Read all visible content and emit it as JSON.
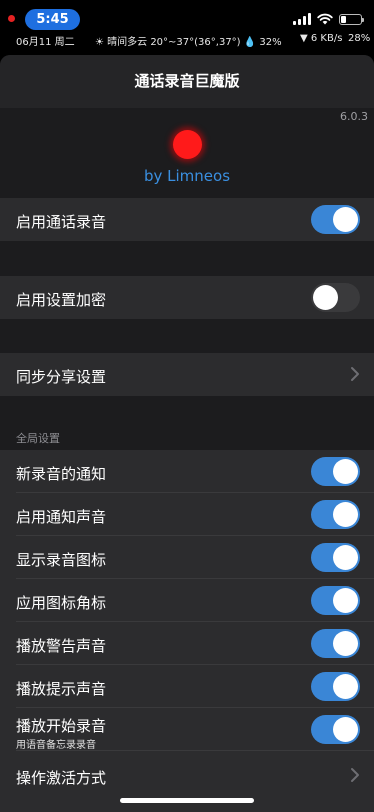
{
  "status_bar": {
    "time": "5:45",
    "battery_level": 0.25
  },
  "info_bar": {
    "date": "06月11 周二",
    "weather": "☀ 晴间多云 20°~37°(36°,37°) 💧 32%",
    "speed": "▼ 6 KB/s",
    "battery_percent": "28%"
  },
  "nav": {
    "title": "通话录音巨魔版"
  },
  "header": {
    "version": "6.0.3",
    "byline": "by Limneos",
    "dot_color": "#ff1a1a"
  },
  "cells": {
    "enable_recording": {
      "label": "启用通话录音",
      "on": true
    },
    "enable_encryption": {
      "label": "启用设置加密",
      "on": false
    },
    "sync_share": {
      "label": "同步分享设置"
    }
  },
  "global": {
    "header": "全局设置",
    "items": [
      {
        "label": "新录音的通知",
        "on": true
      },
      {
        "label": "启用通知声音",
        "on": true
      },
      {
        "label": "显示录音图标",
        "on": true
      },
      {
        "label": "应用图标角标",
        "on": true
      },
      {
        "label": "播放警告声音",
        "on": true
      },
      {
        "label": "播放提示声音",
        "on": true
      },
      {
        "label": "播放开始录音",
        "sublabel": "用语音备忘录录音",
        "on": true
      }
    ],
    "activation": {
      "label": "操作激活方式"
    }
  },
  "colors": {
    "accent": "#3a86d6",
    "background": "#1c1c1e",
    "cell": "#2c2c2e"
  }
}
